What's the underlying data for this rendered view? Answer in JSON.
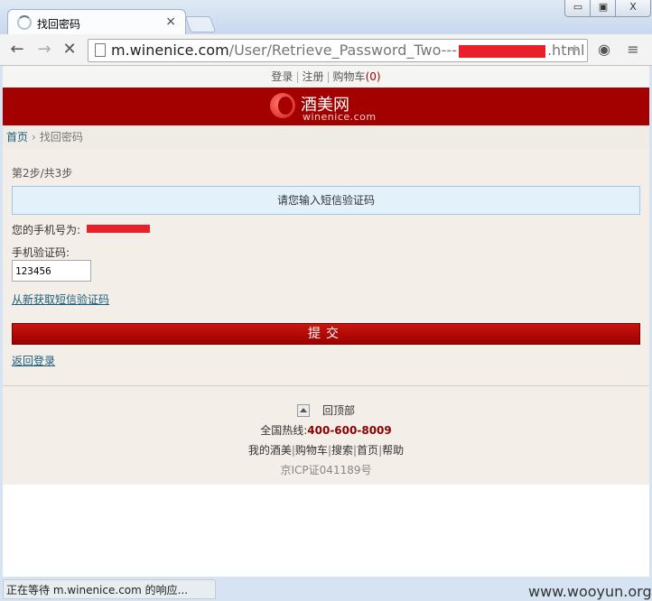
{
  "browser": {
    "tab_title": "找回密码",
    "tab_close": "×",
    "url_host": "m.winenice.com",
    "url_path_start": "/User/Retrieve_Password_Two---",
    "url_path_end": ".html",
    "window_min": "▭",
    "window_max": "▣",
    "window_close": "X",
    "status_text": "正在等待 m.winenice.com 的响应..."
  },
  "site": {
    "topnav": {
      "login": "登录",
      "register": "注册",
      "cart": "购物车",
      "cart_count": "(0)"
    },
    "logo_cn": "酒美网",
    "logo_en": "winenice.com",
    "breadcrumb": {
      "home": "首页",
      "current": "找回密码"
    }
  },
  "form": {
    "step": "第2步/共3步",
    "notice": "请您输入短信验证码",
    "phone_label": "您的手机号为:",
    "code_label": "手机验证码:",
    "code_value": "123456",
    "resend_link": "从新获取短信验证码",
    "submit_label": "提交",
    "back_link": "返回登录"
  },
  "footer": {
    "back_to_top": "回顶部",
    "hotline_label": "全国热线:",
    "hotline_number": "400-600-8009",
    "links": [
      "我的酒美",
      "购物车",
      "搜索",
      "首页",
      "帮助"
    ],
    "icp": "京ICP证041189号"
  },
  "watermark": "www.wooyun.org",
  "colors": {
    "brand_red": "#a30000",
    "link_blue": "#1a5d7b",
    "hotline": "#8b0000"
  }
}
